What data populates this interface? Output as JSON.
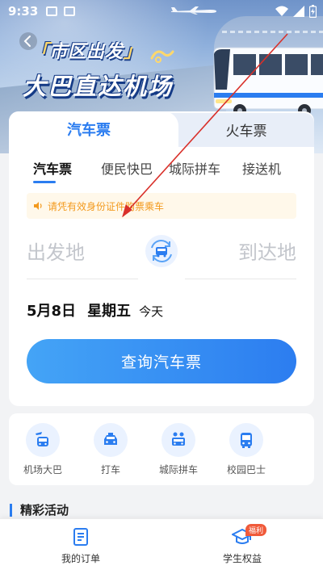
{
  "status_bar": {
    "time": "9:33",
    "icons": [
      "gallery-icon",
      "text-icon",
      "wifi-icon",
      "signal-icon",
      "battery-icon"
    ]
  },
  "banner": {
    "line1": "市区出发",
    "bracket_open": "「",
    "bracket_close": "」",
    "line2": "大巴直达机场",
    "back_icon": "chevron-left-icon"
  },
  "tabs": {
    "bus": "汽车票",
    "train": "火车票"
  },
  "subtabs": [
    "汽车票",
    "便民快巴",
    "城际拼车",
    "接送机"
  ],
  "notice": {
    "icon": "speaker-icon",
    "text": "请凭有效身份证件购票乘车"
  },
  "route": {
    "from_placeholder": "出发地",
    "to_placeholder": "到达地",
    "swap_icon": "swap-bus-icon"
  },
  "date": {
    "date": "5月8日",
    "weekday": "星期五",
    "relative": "今天"
  },
  "search_button": "查询汽车票",
  "services": [
    {
      "label": "机场大巴",
      "icon": "airport-bus-icon"
    },
    {
      "label": "打车",
      "icon": "taxi-icon"
    },
    {
      "label": "城际拼车",
      "icon": "carpool-icon"
    },
    {
      "label": "校园巴士",
      "icon": "campus-bus-icon"
    }
  ],
  "activity_title": "精彩活动",
  "bottom_nav": {
    "orders": "我的订单",
    "student": "学生权益",
    "student_badge": "福利"
  },
  "colors": {
    "accent": "#2b7df0",
    "notice_text": "#f39a1e",
    "notice_bg": "#fff8ea",
    "badge": "#f05a3a",
    "annotation_arrow": "#d9302a"
  }
}
